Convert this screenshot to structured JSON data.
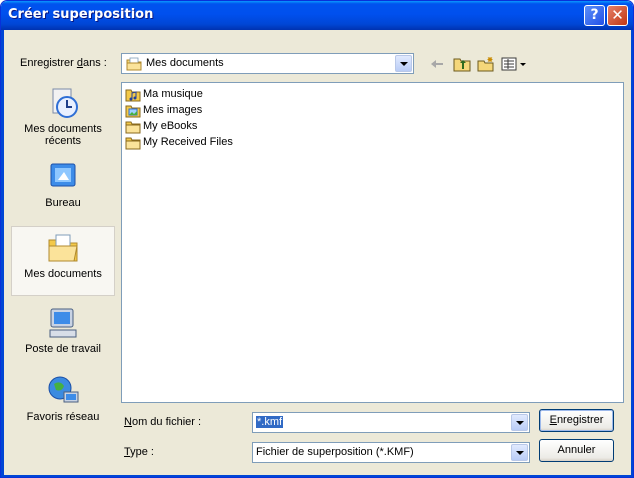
{
  "window": {
    "title": "Créer superposition"
  },
  "titlebar": {
    "help_label": "?",
    "close_label": "✕"
  },
  "toolbar": {
    "save_in_label_pre": "Enregistrer ",
    "save_in_label_key": "d",
    "save_in_label_post": "ans :",
    "save_in_value": "Mes documents",
    "icons": [
      "back-icon",
      "up-folder-icon",
      "new-folder-icon",
      "views-menu-icon"
    ]
  },
  "places": [
    {
      "label": "Mes documents récents",
      "icon": "recent-documents-icon"
    },
    {
      "label": "Bureau",
      "icon": "desktop-icon"
    },
    {
      "label": "Mes documents",
      "icon": "my-documents-icon",
      "selected": true
    },
    {
      "label": "Poste de travail",
      "icon": "my-computer-icon"
    },
    {
      "label": "Favoris réseau",
      "icon": "network-places-icon"
    }
  ],
  "files": [
    {
      "name": "Ma musique",
      "icon": "music-folder-icon"
    },
    {
      "name": "Mes images",
      "icon": "pictures-folder-icon"
    },
    {
      "name": "My eBooks",
      "icon": "folder-icon"
    },
    {
      "name": "My Received Files",
      "icon": "folder-icon"
    }
  ],
  "form": {
    "filename_label_key": "N",
    "filename_label_rest": "om du fichier :",
    "filename_value": "*.kmf",
    "type_label_key": "T",
    "type_label_rest": "ype :",
    "type_value": "Fichier de superposition (*.KMF)"
  },
  "buttons": {
    "save_key": "E",
    "save_rest": "nregistrer",
    "cancel": "Annuler"
  },
  "colors": {
    "titlebar": "#0053EE",
    "selection": "#316AC5",
    "dialog_bg": "#ECE9D8"
  }
}
